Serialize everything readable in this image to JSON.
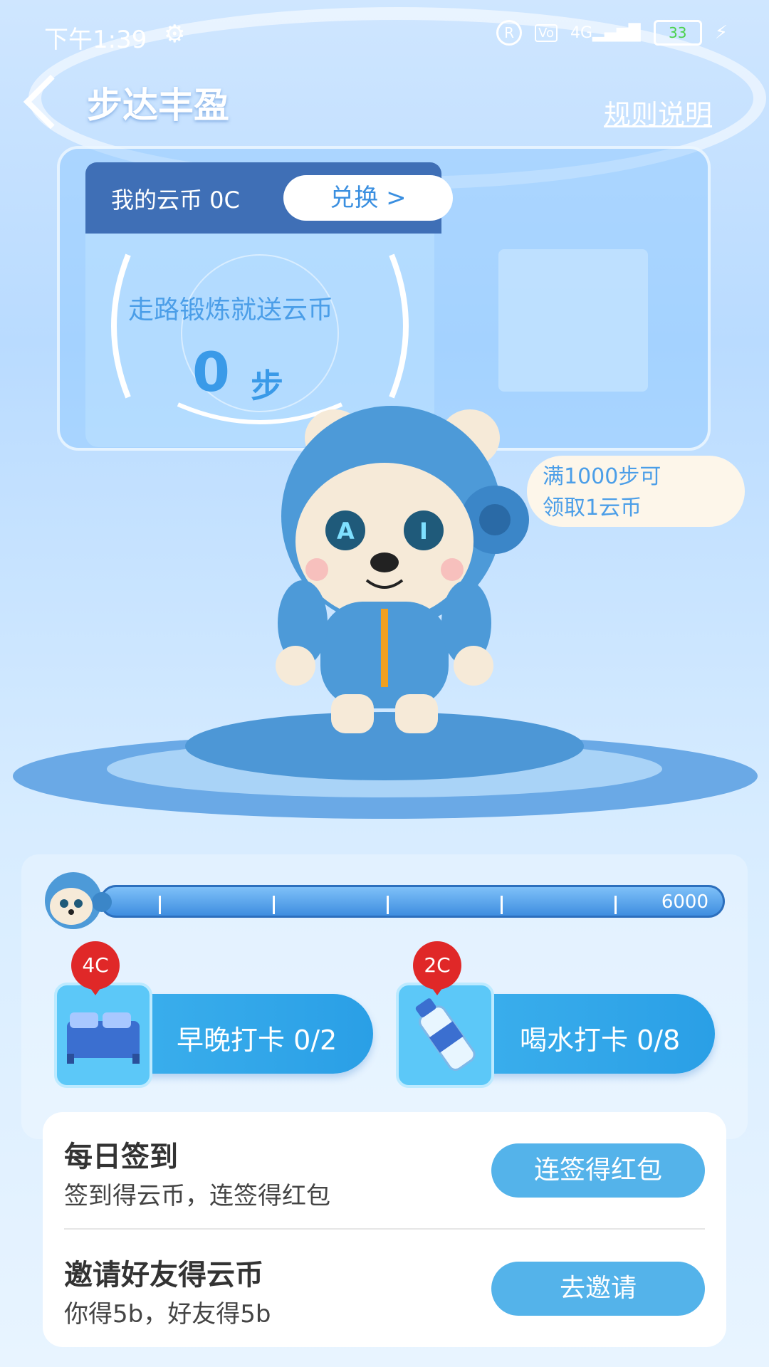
{
  "status_bar": {
    "time": "下午1:39",
    "network": "4G",
    "battery": "33"
  },
  "header": {
    "title": "步达丰盈",
    "rules": "规则说明"
  },
  "coins": {
    "label": "我的云币 0C",
    "exchange": "兑换 >"
  },
  "steps": {
    "title": "走路锻炼就送云币",
    "count": "0",
    "unit": "步"
  },
  "bubble": {
    "line1": "满1000步可",
    "line2": "领取1云币"
  },
  "progress": {
    "max_label": "6000",
    "fraction": 0
  },
  "tasks": [
    {
      "label": "早晚打卡 0/2",
      "badge": "4C",
      "icon": "bed-icon"
    },
    {
      "label": "喝水打卡 0/8",
      "badge": "2C",
      "icon": "water-bottle-icon"
    }
  ],
  "daily": [
    {
      "title": "每日签到",
      "subtitle": "签到得云币，连签得红包",
      "button": "连签得红包"
    },
    {
      "title": "邀请好友得云币",
      "subtitle": "你得5b，好友得5b",
      "button": "去邀请"
    }
  ],
  "colors": {
    "accent": "#3a9ae8",
    "badge": "#e02828",
    "task": "#2a9fe6"
  }
}
